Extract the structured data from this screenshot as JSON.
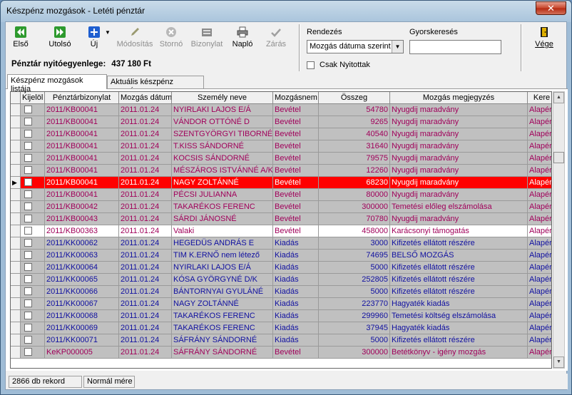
{
  "window": {
    "title": "Készpénz mozgások - Letéti pénztár",
    "close_label": "✕"
  },
  "toolbar": {
    "first": "Első",
    "last": "Utolsó",
    "new": "Új",
    "modify": "Módosítás",
    "cancel": "Stornó",
    "voucher": "Bizonylat",
    "log": "Napló",
    "close": "Zárás",
    "exit": "Vége"
  },
  "opening_balance": {
    "label": "Pénztár nyitóegyenlege:",
    "value": "437 180 Ft"
  },
  "sort": {
    "label": "Rendezés",
    "selected": "Mozgás dátuma szerint"
  },
  "quicksearch": {
    "label": "Gyorskeresés",
    "value": ""
  },
  "only_open": {
    "label": "Csak Nyitottak"
  },
  "tabs": [
    "Készpénz mozgások listája",
    "Aktuális készpénz mozgás"
  ],
  "columns": [
    "Kijelöl",
    "Pénztárbizonylat",
    "Mozgás dátum",
    "Személy neve",
    "Mozgásnem",
    "Összeg",
    "Mozgás megjegyzés",
    "Kere"
  ],
  "colors": {
    "selected": "#ff0000",
    "gray": "#c0c0c0",
    "bevetel_text": "#a0005a",
    "kiadas_text": "#1010a0"
  },
  "rows": [
    {
      "doc": "2011/KB00041",
      "date": "2011.01.24",
      "name": "NYIRLAKI LAJOS E/Á",
      "type": "Bevétel",
      "amount": "54780",
      "note": "Nyugdij maradvány",
      "extra": "Alapér",
      "style": "gray"
    },
    {
      "doc": "2011/KB00041",
      "date": "2011.01.24",
      "name": "VÁNDOR OTTÓNÉ D",
      "type": "Bevétel",
      "amount": "9265",
      "note": "Nyugdij maradvány",
      "extra": "Alapér",
      "style": "gray"
    },
    {
      "doc": "2011/KB00041",
      "date": "2011.01.24",
      "name": "SZENTGYÖRGYI TIBORNÉ",
      "type": "Bevétel",
      "amount": "40540",
      "note": "Nyugdij maradvány",
      "extra": "Alapér",
      "style": "gray"
    },
    {
      "doc": "2011/KB00041",
      "date": "2011.01.24",
      "name": "T.KISS SÁNDORNÉ",
      "type": "Bevétel",
      "amount": "31640",
      "note": "Nyugdij maradvány",
      "extra": "Alapér",
      "style": "gray"
    },
    {
      "doc": "2011/KB00041",
      "date": "2011.01.24",
      "name": "KOCSIS SÁNDORNÉ",
      "type": "Bevétel",
      "amount": "79575",
      "note": "Nyugdij maradvány",
      "extra": "Alapér",
      "style": "gray"
    },
    {
      "doc": "2011/KB00041",
      "date": "2011.01.24",
      "name": "MÉSZÁROS ISTVÁNNÉ A/K",
      "type": "Bevétel",
      "amount": "12260",
      "note": "Nyugdij maradvány",
      "extra": "Alapér",
      "style": "gray"
    },
    {
      "doc": "2011/KB00041",
      "date": "2011.01.24",
      "name": "NAGY ZOLTÁNNÉ",
      "type": "Bevétel",
      "amount": "68230",
      "note": "Nyugdij maradvány",
      "extra": "Alapér",
      "style": "selected"
    },
    {
      "doc": "2011/KB00041",
      "date": "2011.01.24",
      "name": "PÉCSI JULIANNA",
      "type": "Bevétel",
      "amount": "80000",
      "note": "Nyugdij maradvány",
      "extra": "Alapér",
      "style": "gray"
    },
    {
      "doc": "2011/KB00042",
      "date": "2011.01.24",
      "name": "TAKARÉKOS FERENC",
      "type": "Bevétel",
      "amount": "300000",
      "note": "Temetési előleg elszámolása",
      "extra": "Alapér",
      "style": "gray"
    },
    {
      "doc": "2011/KB00043",
      "date": "2011.01.24",
      "name": "SÁRDI JÁNOSNÉ",
      "type": "Bevétel",
      "amount": "70780",
      "note": "Nyugdij maradvány",
      "extra": "Alapér",
      "style": "gray"
    },
    {
      "doc": "2011/KB00363",
      "date": "2011.01.24",
      "name": "Valaki",
      "type": "Bevétel",
      "amount": "458000",
      "note": "Karácsonyi támogatás",
      "extra": "Alapér",
      "style": "white"
    },
    {
      "doc": "2011/KK00062",
      "date": "2011.01.24",
      "name": "HEGEDÜS ANDRÁS E",
      "type": "Kiadás",
      "amount": "3000",
      "note": "Kifizetés ellátott részére",
      "extra": "Alapér",
      "style": "gray-blue"
    },
    {
      "doc": "2011/KK00063",
      "date": "2011.01.24",
      "name": "TIM K.ERNŐ nem létező",
      "type": "Kiadás",
      "amount": "74695",
      "note": "BELSŐ MOZGÁS",
      "extra": "Alapér",
      "style": "gray-blue"
    },
    {
      "doc": "2011/KK00064",
      "date": "2011.01.24",
      "name": "NYIRLAKI LAJOS E/Á",
      "type": "Kiadás",
      "amount": "5000",
      "note": "Kifizetés ellátott részére",
      "extra": "Alapér",
      "style": "gray-blue"
    },
    {
      "doc": "2011/KK00065",
      "date": "2011.01.24",
      "name": "KÓSA GYÖRGYNÉ D/K",
      "type": "Kiadás",
      "amount": "252805",
      "note": "Kifizetés ellátott részére",
      "extra": "Alapér",
      "style": "gray-blue"
    },
    {
      "doc": "2011/KK00066",
      "date": "2011.01.24",
      "name": "BÁNTORNYAI GYULÁNÉ",
      "type": "Kiadás",
      "amount": "5000",
      "note": "Kifizetés ellátott részére",
      "extra": "Alapér",
      "style": "gray-blue"
    },
    {
      "doc": "2011/KK00067",
      "date": "2011.01.24",
      "name": "NAGY ZOLTÁNNÉ",
      "type": "Kiadás",
      "amount": "223770",
      "note": "Hagyaték kiadás",
      "extra": "Alapér",
      "style": "gray-blue"
    },
    {
      "doc": "2011/KK00068",
      "date": "2011.01.24",
      "name": "TAKARÉKOS FERENC",
      "type": "Kiadás",
      "amount": "299960",
      "note": "Temetési költség elszámolása",
      "extra": "Alapér",
      "style": "gray-blue"
    },
    {
      "doc": "2011/KK00069",
      "date": "2011.01.24",
      "name": "TAKARÉKOS FERENC",
      "type": "Kiadás",
      "amount": "37945",
      "note": "Hagyaték kiadás",
      "extra": "Alapér",
      "style": "gray-blue"
    },
    {
      "doc": "2011/KK00071",
      "date": "2011.01.24",
      "name": "SÁFRÁNY SÁNDORNÉ",
      "type": "Kiadás",
      "amount": "5000",
      "note": "Kifizetés ellátott részére",
      "extra": "Alapér",
      "style": "gray-blue"
    },
    {
      "doc": "KeKP000005",
      "date": "2011.01.24",
      "name": "SÁFRÁNY SÁNDORNÉ",
      "type": "Bevétel",
      "amount": "300000",
      "note": "Betétkönyv - igény mozgás",
      "extra": "Alapér",
      "style": "gray"
    }
  ],
  "status": {
    "records": "2866 db rekord",
    "mode": "Normál mére"
  }
}
